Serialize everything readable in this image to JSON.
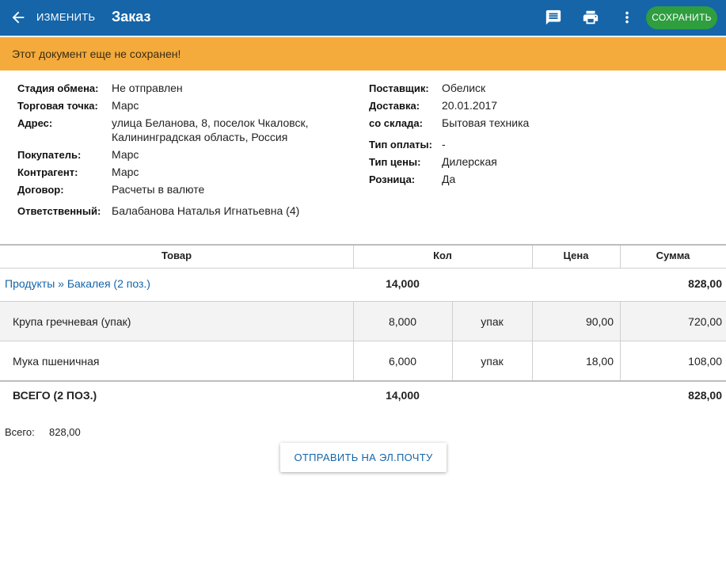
{
  "header": {
    "edit_label": "ИЗМЕНИТЬ",
    "title": "Заказ",
    "save_label": "СОХРАНИТЬ",
    "icons": [
      "arrow-back-icon",
      "comment-icon",
      "print-icon",
      "more-vert-icon"
    ]
  },
  "warning": {
    "text": "Этот документ еще не сохранен!"
  },
  "details": {
    "left": {
      "stage_label": "Стадия обмена:",
      "stage_value": "Не отправлен",
      "outlet_label": "Торговая точка:",
      "outlet_value": "Марс",
      "address_label": "Адрес:",
      "address_line1": "улица Беланова, 8, поселок Чкаловск,",
      "address_line2": "Калининградская область, Россия",
      "buyer_label": "Покупатель:",
      "buyer_value": "Марс",
      "counterparty_label": "Контрагент:",
      "counterparty_value": "Марс",
      "contract_label": "Договор:",
      "contract_value": "Расчеты в валюте",
      "responsible_label": "Ответственный:",
      "responsible_value": "Балабанова Наталья Игнатьевна (4)"
    },
    "right": {
      "supplier_label": "Поставщик:",
      "supplier_value": "Обелиск",
      "delivery_label": "Доставка:",
      "delivery_value": "20.01.2017",
      "warehouse_label": "со склада:",
      "warehouse_value": "Бытовая техника",
      "payment_label": "Тип оплаты:",
      "payment_value": "-",
      "price_type_label": "Тип цены:",
      "price_type_value": "Дилерская",
      "retail_label": "Розница:",
      "retail_value": "Да"
    }
  },
  "table": {
    "headers": {
      "product": "Товар",
      "qty": "Кол",
      "price": "Цена",
      "sum": "Сумма"
    },
    "group": {
      "name": "Продукты » Бакалея (2 поз.)",
      "qty": "14,000",
      "sum": "828,00"
    },
    "rows": [
      {
        "name": "Крупа гречневая (упак)",
        "qty": "8,000",
        "unit": "упак",
        "price": "90,00",
        "sum": "720,00"
      },
      {
        "name": "Мука пшеничная",
        "qty": "6,000",
        "unit": "упак",
        "price": "18,00",
        "sum": "108,00"
      }
    ],
    "total": {
      "label": "ВСЕГО (2 ПОЗ.)",
      "qty": "14,000",
      "sum": "828,00"
    }
  },
  "summary": {
    "label": "Всего:",
    "value": "828,00"
  },
  "email_button": "ОТПРАВИТЬ НА ЭЛ.ПОЧТУ",
  "colors": {
    "primary": "#1565a8",
    "warning": "#f4ab3b",
    "save": "#2e9e3f"
  }
}
